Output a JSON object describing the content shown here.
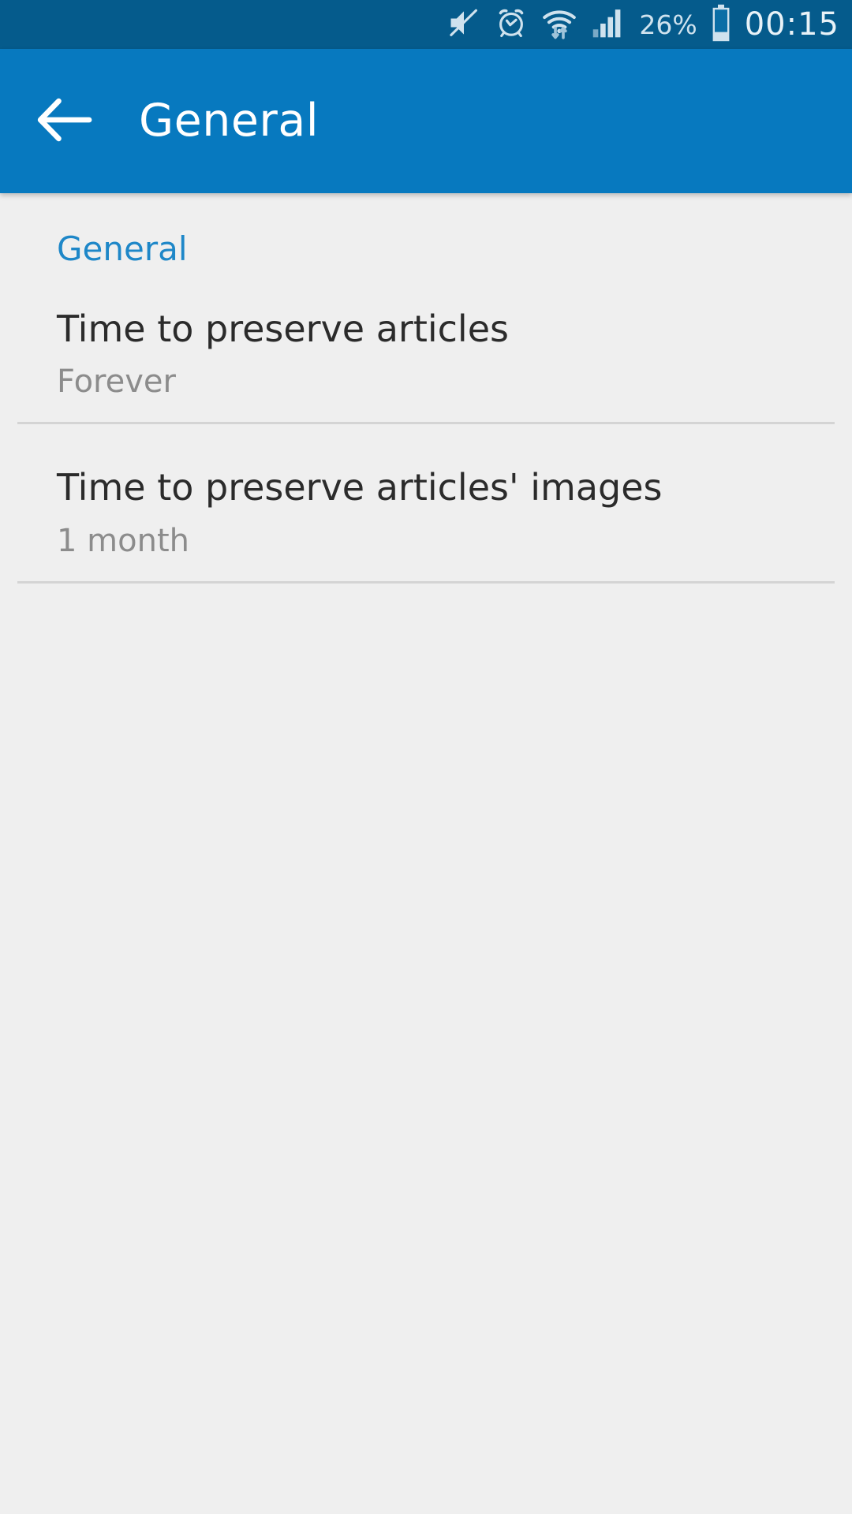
{
  "status_bar": {
    "background_color": "#055b8c",
    "icon_color": "#cfe2ee",
    "battery_percent": "26%",
    "clock": "00:15",
    "icons": [
      {
        "name": "mute-icon",
        "label": "Sound muted"
      },
      {
        "name": "alarm-clock-icon",
        "label": "Alarm set"
      },
      {
        "name": "wifi-icon",
        "label": "Wi-Fi connected with data transfer"
      },
      {
        "name": "cellular-signal-icon",
        "label": "Mobile signal full"
      },
      {
        "name": "battery-icon",
        "label": "Battery 26 percent"
      }
    ]
  },
  "app_bar": {
    "background_color": "#0779bf",
    "title": "General",
    "back_icon": "arrow-left-icon"
  },
  "content": {
    "background_color": "#efefef",
    "section_header": "General",
    "section_header_color": "#1e87c8",
    "items": [
      {
        "title": "Time to preserve articles",
        "subtitle": "Forever"
      },
      {
        "title": "Time to preserve articles' images",
        "subtitle": "1 month"
      }
    ]
  }
}
